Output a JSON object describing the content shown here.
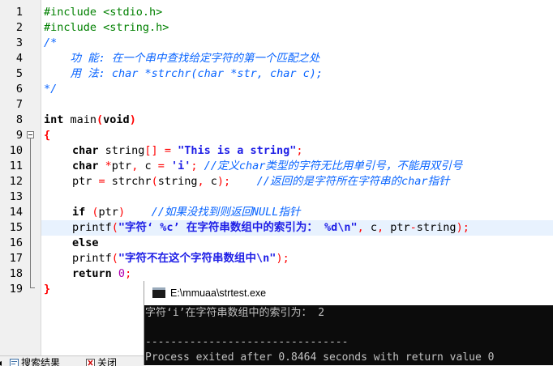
{
  "editor": {
    "line_numbers": [
      "1",
      "2",
      "3",
      "4",
      "5",
      "6",
      "7",
      "8",
      "9",
      "10",
      "11",
      "12",
      "13",
      "14",
      "15",
      "16",
      "17",
      "18",
      "19"
    ],
    "highlighted_line": 15,
    "code": {
      "l1": {
        "text": "#include <stdio.h>"
      },
      "l2": {
        "text": "#include <string.h>"
      },
      "l3": {
        "text": "/*"
      },
      "l4": {
        "text": "    功 能: 在一个串中查找给定字符的第一个匹配之处"
      },
      "l5": {
        "text": "    用 法: char *strchr(char *str, char c);"
      },
      "l6": {
        "text": "*/"
      },
      "l8": {
        "kw": "int",
        "rest": " main",
        "p1": "(",
        "arg": "void",
        "p2": ")"
      },
      "l9": {
        "brace": "{"
      },
      "l10": {
        "kw": "char",
        "a": " string",
        "b": "[]",
        "c": " ",
        "d": "=",
        "e": " ",
        "str": "\"This is a string\"",
        "f": ";"
      },
      "l11": {
        "kw": "char",
        "a": " ",
        "b": "*",
        "c": "ptr",
        "d": ",",
        "e": " c ",
        "f": "=",
        "g": " ",
        "ch": "'i'",
        "h": ";",
        "comment": " //定义char类型的字符无比用单引号，不能用双引号"
      },
      "l12": {
        "a": "ptr ",
        "b": "=",
        "c": " strchr",
        "d": "(",
        "e": "string",
        "f": ",",
        "g": " c",
        "h": ")",
        "i": ";",
        "comment": "    //返回的是字符所在字符串的char指针"
      },
      "l14": {
        "kw": "if",
        "a": " ",
        "b": "(",
        "c": "ptr",
        "d": ")",
        "comment": "    //如果没找到则返回NULL指针"
      },
      "l15": {
        "a": "printf",
        "b": "(",
        "str": "\"字符‘ %c’ 在字符串数组中的索引为： %d\\n\"",
        "c": ",",
        "d": " c",
        "e": ",",
        "f": " ptr",
        "g": "-",
        "h": "string",
        "i": ")",
        "j": ";"
      },
      "l16": {
        "kw": "else"
      },
      "l17": {
        "a": "printf",
        "b": "(",
        "str": "\"字符不在这个字符串数组中\\n\"",
        "c": ")",
        "d": ";"
      },
      "l18": {
        "kw": "return",
        "a": " ",
        "num": "0",
        "b": ";"
      },
      "l19": {
        "brace": "}"
      }
    }
  },
  "bottom_tabs": {
    "tab1": "搜索结果",
    "tab2": "关闭"
  },
  "console": {
    "title": "E:\\mmuaa\\strtest.exe",
    "lines": [
      "字符‘i’在字符串数组中的索引为： 2",
      "",
      "--------------------------------",
      "Process exited after 0.8464 seconds with return value 0"
    ]
  },
  "colors": {
    "preprocessor": "#008000",
    "comment": "#0a65ff",
    "string": "#1e1ee6",
    "number": "#b000b0",
    "symbol": "#ff0000",
    "highlight_line": "#e8f2fe",
    "console_bg": "#0c0c0c",
    "console_text": "#c0c0c0"
  }
}
